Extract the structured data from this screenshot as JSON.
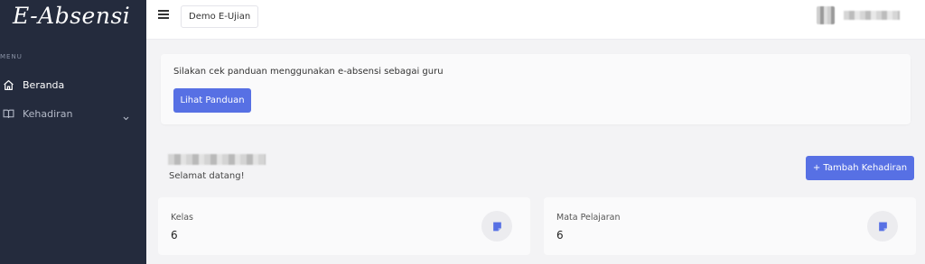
{
  "app": {
    "logo": "E-Absensi"
  },
  "sidebar": {
    "menu_label": "MENU",
    "items": [
      {
        "label": "Beranda",
        "icon": "home-icon",
        "active": true
      },
      {
        "label": "Kehadiran",
        "icon": "book-icon",
        "active": false,
        "has_submenu": true
      }
    ]
  },
  "topbar": {
    "project": "Demo E-Ujian"
  },
  "notice": {
    "text": "Silakan cek panduan menggunakan e-absensi sebagai guru",
    "button_label": "Lihat Panduan"
  },
  "greeting": {
    "welcome": "Selamat datang!"
  },
  "actions": {
    "add_label": "+ Tambah Kehadiran"
  },
  "stats": [
    {
      "label": "Kelas",
      "value": "6",
      "icon": "note-icon"
    },
    {
      "label": "Mata Pelajaran",
      "value": "6",
      "icon": "note-icon"
    }
  ],
  "colors": {
    "sidebar_bg": "#242b3d",
    "primary": "#5770e4",
    "page_bg": "#f3f3f5"
  }
}
